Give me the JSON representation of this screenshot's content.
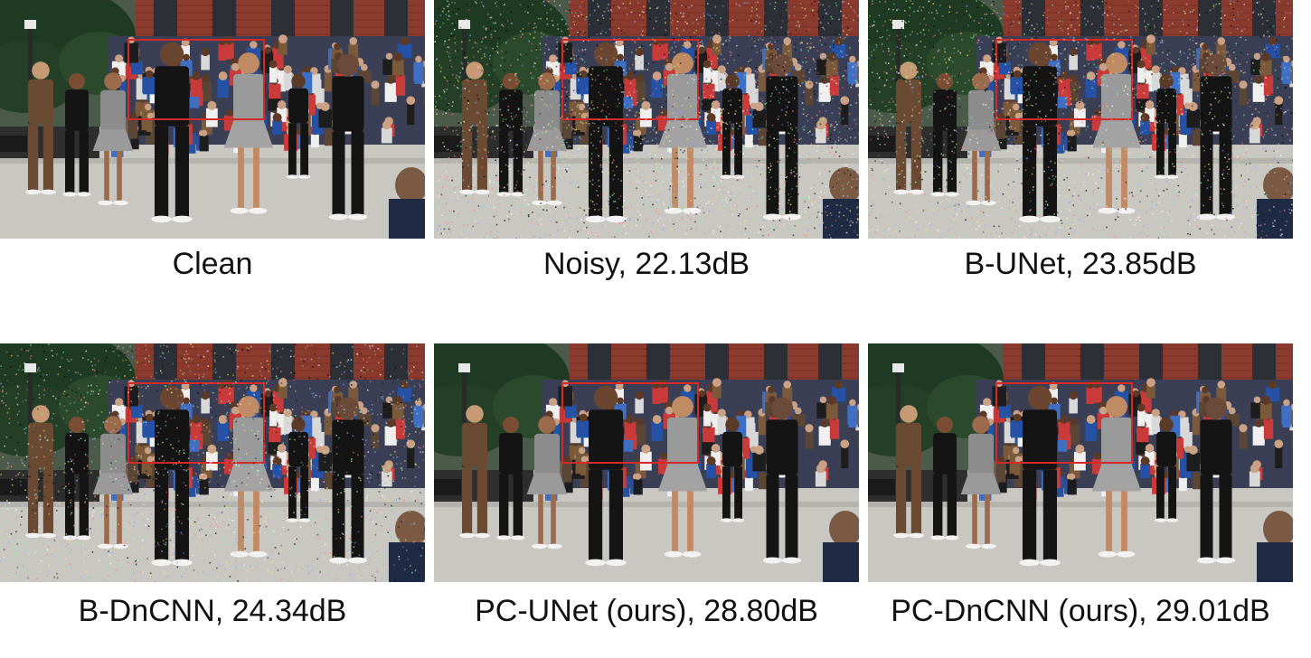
{
  "figure": {
    "panels": [
      {
        "id": "clean",
        "caption": "Clean",
        "noise_level": 0.0
      },
      {
        "id": "noisy",
        "caption": "Noisy, 22.13dB",
        "noise_level": 1.0
      },
      {
        "id": "b-unet",
        "caption": "B-UNet,  23.85dB",
        "noise_level": 0.8
      },
      {
        "id": "b-dncnn",
        "caption": "B-DnCNN,  24.34dB",
        "noise_level": 0.7
      },
      {
        "id": "pc-unet",
        "caption": "PC-UNet (ours),  28.80dB",
        "noise_level": 0.0
      },
      {
        "id": "pc-dncnn",
        "caption": "PC-DnCNN (ours),  29.01dB",
        "noise_level": 0.0
      }
    ],
    "colors": {
      "highlight_box": "#d42a2a",
      "brick_wall": "#8b3a2e",
      "pavement": "#c9c7c2",
      "tree": "#1f3a22",
      "crowd": "#3a3f55",
      "dancer_black": "#141414"
    }
  }
}
